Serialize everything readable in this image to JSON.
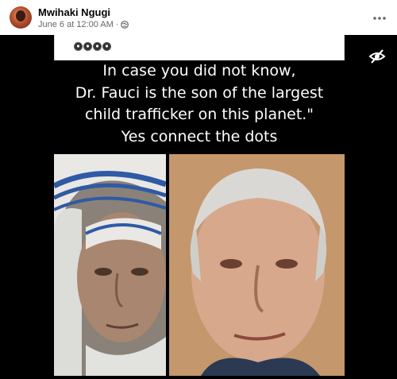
{
  "post": {
    "author": "Mwihaki Ngugi",
    "timestamp": "June 6 at 12:00 AM",
    "separator": "·",
    "privacy_icon": "globe-icon",
    "more_icon": "more-horizontal-icon"
  },
  "image": {
    "emoji_text": "",
    "caption_lines": [
      "In case you did not know,",
      "Dr. Fauci is the son of the largest",
      "child trafficker on this planet.\"",
      "Yes connect the dots"
    ],
    "overlay_icon": "eye-slash-icon"
  },
  "colors": {
    "header_bg": "#ffffff",
    "media_bg": "#000000",
    "text_primary": "#050505",
    "text_secondary": "#65676b"
  }
}
